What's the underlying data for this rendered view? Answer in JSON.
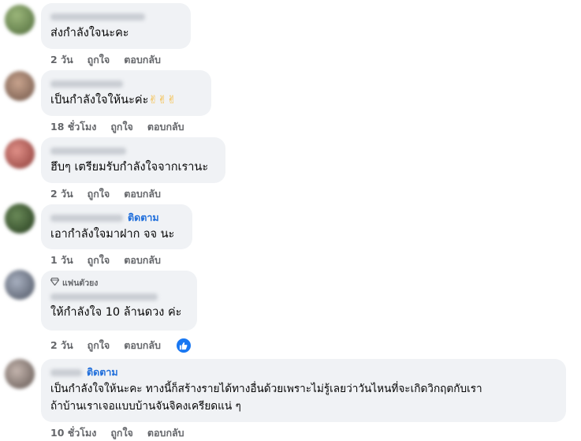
{
  "comments": [
    {
      "text": "ส่งกำลังใจนะคะ",
      "time": "2 วัน",
      "like": "ถูกใจ",
      "reply": "ตอบกลับ",
      "avatar_color": "#6f8a58"
    },
    {
      "text": "เป็นกำลังใจให้นะค่ะ",
      "emoji": "✌✌✌",
      "time": "18 ชั่วโมง",
      "like": "ถูกใจ",
      "reply": "ตอบกลับ",
      "avatar_color": "#9a7b6a"
    },
    {
      "text": "ฮึบๆ เตรียมรับกำลังใจจากเรานะ",
      "time": "2 วัน",
      "like": "ถูกใจ",
      "reply": "ตอบกลับ",
      "avatar_color": "#b45a55"
    },
    {
      "follow": "ติดตาม",
      "text": "เอากำลังใจมาฝาก จจ นะ",
      "time": "1 วัน",
      "like": "ถูกใจ",
      "reply": "ตอบกลับ",
      "avatar_color": "#3d5a33"
    },
    {
      "badge": "แฟนตัวยง",
      "text": "ให้กำลังใจ 10 ล้านดวง ค่ะ",
      "time": "2 วัน",
      "like": "ถูกใจ",
      "reply": "ตอบกลับ",
      "avatar_color": "#7d8596"
    },
    {
      "follow": "ติดตาม",
      "text_line1": "เป็นกำลังใจให้นะคะ ทางนี้ก็สร้างรายได้ทางอื่นด้วยเพราะไม่รู้เลยว่าวันไหนที่จะเกิดวิกฤตกับเรา",
      "text_line2": "ถ้าบ้านเราเจอแบบบ้านจันจิคงเครียดแน่ ๆ",
      "time": "10 ชั่วโมง",
      "like": "ถูกใจ",
      "reply": "ตอบกลับ",
      "avatar_color": "#8c7f78"
    }
  ]
}
